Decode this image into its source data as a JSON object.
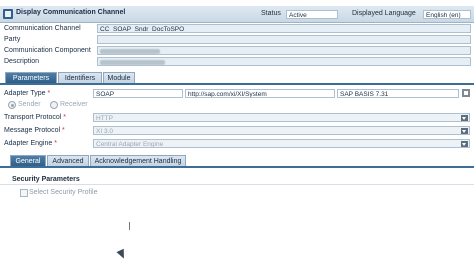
{
  "header": {
    "title": "Display Communication Channel",
    "status_label": "Status",
    "status_value": "Active",
    "language_label": "Displayed Language",
    "language_value": "English (en)"
  },
  "fields": {
    "comm_channel_label": "Communication Channel",
    "comm_channel_value": "CC_SOAP_Sndr_DocToSPO",
    "party_label": "Party",
    "comm_component_label": "Communication Component",
    "description_label": "Description"
  },
  "main_tabs": [
    "Parameters",
    "Identifiers",
    "Module"
  ],
  "adapter": {
    "type_label": "Adapter Type",
    "type_value": "SOAP",
    "namespace_value": "http://sap.com/xi/XI/System",
    "sw_version_value": "SAP BASIS 7.31",
    "sender_label": "Sender",
    "receiver_label": "Receiver",
    "transport_label": "Transport Protocol",
    "transport_value": "HTTP",
    "message_label": "Message Protocol",
    "message_value": "XI 3.0",
    "engine_label": "Adapter Engine",
    "engine_value": "Central Adapter Engine"
  },
  "sub_tabs": [
    "General",
    "Advanced",
    "Acknowledgement Handling"
  ],
  "security": {
    "section_title": "Security Parameters",
    "checkbox_label": "Select Security Profile"
  },
  "required_mark": "*"
}
